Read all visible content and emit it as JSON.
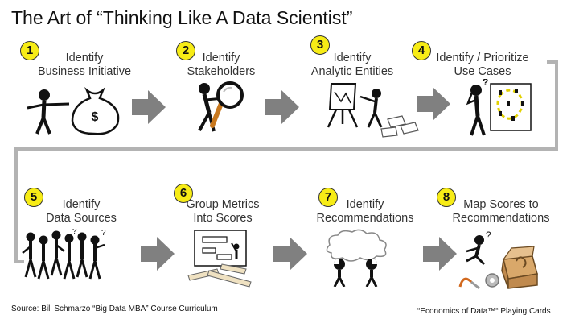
{
  "title": "The Art of “Thinking Like A Data Scientist”",
  "steps": [
    {
      "num": "1",
      "line1": "Identify",
      "line2": "Business Initiative"
    },
    {
      "num": "2",
      "line1": "Identify",
      "line2": "Stakeholders"
    },
    {
      "num": "3",
      "line1": "Identify",
      "line2": "Analytic Entities"
    },
    {
      "num": "4",
      "line1": "Identify / Prioritize",
      "line2": "Use Cases"
    },
    {
      "num": "5",
      "line1": "Identify",
      "line2": "Data Sources"
    },
    {
      "num": "6",
      "line1": "Group Metrics",
      "line2": "Into Scores"
    },
    {
      "num": "7",
      "line1": "Identify",
      "line2": "Recommendations"
    },
    {
      "num": "8",
      "line1": "Map Scores to",
      "line2": "Recommendations"
    }
  ],
  "money_symbol": "$",
  "question_mark": "?",
  "footer": {
    "source": "Source: Bill Schmarzo “Big Data MBA” Course Curriculum",
    "cards": "“Economics of Data™“ Playing Cards"
  },
  "colors": {
    "badge": "#f7ec16",
    "arrow": "#808080",
    "connector": "#b3b3b3",
    "text": "#333333"
  }
}
